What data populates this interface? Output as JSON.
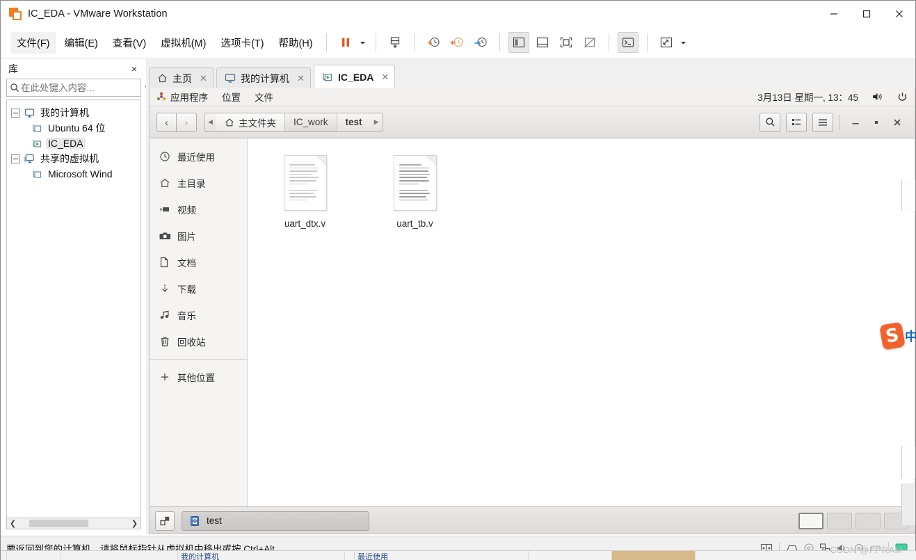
{
  "window": {
    "title": "IC_EDA - VMware Workstation",
    "app_icon": "vmware-icon",
    "minimize_label": "最小化",
    "maximize_label": "最大化",
    "close_label": "关闭"
  },
  "menubar": {
    "items": [
      {
        "label": "文件(F)",
        "name": "menu-file"
      },
      {
        "label": "编辑(E)",
        "name": "menu-edit"
      },
      {
        "label": "查看(V)",
        "name": "menu-view"
      },
      {
        "label": "虚拟机(M)",
        "name": "menu-vm"
      },
      {
        "label": "选项卡(T)",
        "name": "menu-tabs"
      },
      {
        "label": "帮助(H)",
        "name": "menu-help"
      }
    ],
    "toolbar": [
      {
        "name": "suspend-button",
        "icon": "pause-icon"
      },
      {
        "name": "power-dropdown",
        "icon": "chevron-down-icon"
      },
      {
        "name": "manage-snapshot-button",
        "icon": "snapshot-manager-icon"
      },
      {
        "name": "take-snapshot-button",
        "icon": "snapshot-add-icon"
      },
      {
        "name": "revert-snapshot-button",
        "icon": "snapshot-revert-icon"
      },
      {
        "name": "snapshot-manager-button",
        "icon": "snapshot-wrench-icon"
      },
      {
        "name": "show-library-button",
        "icon": "sidebar-panel-icon"
      },
      {
        "name": "show-thumbnail-button",
        "icon": "thumbnail-bar-icon"
      },
      {
        "name": "full-screen-button",
        "icon": "fullscreen-icon"
      },
      {
        "name": "unity-mode-button",
        "icon": "unity-mode-icon"
      },
      {
        "name": "console-button",
        "icon": "terminal-icon"
      },
      {
        "name": "stretch-button",
        "icon": "stretch-arrows-icon"
      },
      {
        "name": "stretch-dropdown",
        "icon": "chevron-down-icon"
      }
    ]
  },
  "library": {
    "title": "库",
    "close_label": "×",
    "search_placeholder": "在此处键入内容...",
    "search_value": "",
    "tree": [
      {
        "label": "我的计算机",
        "icon": "monitor-icon",
        "level": 0,
        "expanded": true,
        "selected": false,
        "name": "tree-item-my-computer"
      },
      {
        "label": "Ubuntu 64 位",
        "icon": "vm-icon",
        "level": 1,
        "expanded": false,
        "selected": false,
        "name": "tree-item-ubuntu-64"
      },
      {
        "label": "IC_EDA",
        "icon": "vm-running-icon",
        "level": 1,
        "expanded": false,
        "selected": true,
        "name": "tree-item-ic-eda"
      },
      {
        "label": "共享的虚拟机",
        "icon": "shared-vm-icon",
        "level": 0,
        "expanded": true,
        "selected": false,
        "name": "tree-item-shared-vms"
      },
      {
        "label": "Microsoft Wind",
        "icon": "vm-icon",
        "level": 1,
        "expanded": false,
        "selected": false,
        "name": "tree-item-microsoft-windows"
      }
    ]
  },
  "tabs": [
    {
      "label": "主页",
      "icon": "home-icon",
      "active": false,
      "closable": true,
      "name": "tab-home"
    },
    {
      "label": "我的计算机",
      "icon": "monitor-icon",
      "active": false,
      "closable": true,
      "name": "tab-my-computer"
    },
    {
      "label": "IC_EDA",
      "icon": "vm-running-icon",
      "active": true,
      "closable": true,
      "name": "tab-ic-eda"
    }
  ],
  "guest": {
    "panel": {
      "applications": "应用程序",
      "places": "位置",
      "files": "文件",
      "clock": "3月13日 星期一, 13：45",
      "volume_icon": "volume-icon",
      "power_icon": "power-icon"
    },
    "filemanager": {
      "back_label": "‹",
      "forward_label": "›",
      "breadcrumbs": [
        {
          "label": "主文件夹",
          "icon": "home-icon",
          "current": false,
          "name": "breadcrumb-home"
        },
        {
          "label": "IC_work",
          "icon": "",
          "current": false,
          "name": "breadcrumb-ic-work"
        },
        {
          "label": "test",
          "icon": "",
          "current": true,
          "name": "breadcrumb-test"
        }
      ],
      "search_icon": "search-icon",
      "view_toggle_icon": "list-view-icon",
      "menu_icon": "hamburger-menu-icon",
      "minimize_label": "—",
      "maximize_label": "▪",
      "close_label": "✕",
      "places": [
        {
          "label": "最近使用",
          "icon": "clock-icon",
          "name": "place-recent"
        },
        {
          "label": "主目录",
          "icon": "home-icon",
          "name": "place-home"
        },
        {
          "label": "视频",
          "icon": "video-icon",
          "name": "place-videos"
        },
        {
          "label": "图片",
          "icon": "camera-icon",
          "name": "place-pictures"
        },
        {
          "label": "文档",
          "icon": "document-icon",
          "name": "place-documents"
        },
        {
          "label": "下载",
          "icon": "download-icon",
          "name": "place-downloads"
        },
        {
          "label": "音乐",
          "icon": "music-icon",
          "name": "place-music"
        },
        {
          "label": "回收站",
          "icon": "trash-icon",
          "name": "place-trash"
        },
        {
          "label": "其他位置",
          "icon": "plus-icon",
          "name": "place-other-locations"
        }
      ],
      "files": [
        {
          "name": "uart_dtx.v",
          "icon": "text-document-icon"
        },
        {
          "name": "uart_tb.v",
          "icon": "text-document-icon"
        }
      ],
      "taskbar": {
        "show_desktop_icon": "show-desktop-icon",
        "task_label": "test",
        "task_icon": "file-manager-icon"
      },
      "workspaces": [
        {
          "active": true,
          "name": "workspace-1"
        },
        {
          "active": false,
          "name": "workspace-2"
        },
        {
          "active": false,
          "name": "workspace-3"
        },
        {
          "active": false,
          "name": "workspace-4"
        }
      ]
    }
  },
  "sogou": {
    "logo": "sogou-ime-icon",
    "label": "中"
  },
  "statusbar": {
    "message": "要返回到您的计算机，请将鼠标指针从虚拟机中移出或按 Ctrl+Alt。",
    "icons": [
      {
        "name": "send-ctrl-alt-del-icon",
        "connected": false
      },
      {
        "name": "hard-disk-icon",
        "connected": true
      },
      {
        "name": "cd-dvd-icon",
        "connected": false
      },
      {
        "name": "network-adapter-icon",
        "connected": true
      },
      {
        "name": "sound-card-icon",
        "connected": true
      },
      {
        "name": "printer-icon",
        "connected": false
      },
      {
        "name": "usb-device-icon",
        "connected": false
      },
      {
        "name": "display-icon",
        "connected": false
      }
    ],
    "watermark": "CSDN @FPRAM"
  }
}
